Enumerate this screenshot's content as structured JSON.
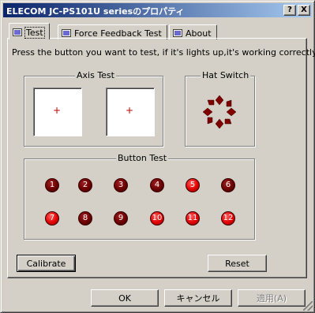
{
  "window": {
    "title": "ELECOM JC-PS101U seriesのプロパティ",
    "help_button": "?",
    "close_button": "X"
  },
  "tabs": [
    {
      "label": "Test",
      "active": true,
      "icon": "controller-icon"
    },
    {
      "label": "Force Feedback Test",
      "active": false,
      "icon": "controller-icon"
    },
    {
      "label": "About",
      "active": false,
      "icon": "controller-icon"
    }
  ],
  "test_page": {
    "instruction": "Press the button you want to test, if it's lights up,it's working correctly.",
    "axis_test": {
      "label": "Axis Test",
      "crosshair_left": "+",
      "crosshair_right": "+"
    },
    "hat_switch": {
      "label": "Hat Switch"
    },
    "button_test": {
      "label": "Button Test",
      "buttons": [
        {
          "label": "1",
          "lit": false
        },
        {
          "label": "2",
          "lit": false
        },
        {
          "label": "3",
          "lit": false
        },
        {
          "label": "4",
          "lit": false
        },
        {
          "label": "5",
          "lit": true
        },
        {
          "label": "6",
          "lit": false
        },
        {
          "label": "7",
          "lit": true
        },
        {
          "label": "8",
          "lit": false
        },
        {
          "label": "9",
          "lit": false
        },
        {
          "label": "10",
          "lit": true
        },
        {
          "label": "11",
          "lit": true
        },
        {
          "label": "12",
          "lit": true
        }
      ]
    },
    "calibrate_label": "Calibrate",
    "reset_label": "Reset"
  },
  "footer": {
    "ok_label": "OK",
    "cancel_label": "キャンセル",
    "apply_label": "適用(A)"
  },
  "colors": {
    "titlebar_start": "#0a246a",
    "titlebar_end": "#a6caf0",
    "face": "#d4d0c8",
    "indicator_on": "#e00000",
    "indicator_off": "#6a0000",
    "hat_fill": "#800000"
  }
}
